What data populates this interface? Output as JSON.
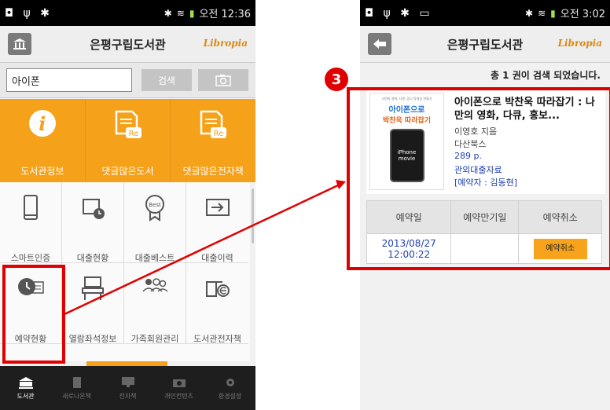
{
  "left_screen": {
    "status_time": "오전 12:36",
    "app_title": "은평구립도서관",
    "logo": "Libropia",
    "home_icon": "library-building-icon",
    "search": {
      "value": "아이폰",
      "button_label": "검색",
      "camera_icon": "camera-icon"
    },
    "orange_tiles": [
      {
        "label": "도서관정보",
        "icon": "info-icon"
      },
      {
        "label": "댓글많은도서",
        "icon": "reply-document-icon"
      },
      {
        "label": "댓글많은전자책",
        "icon": "reply-document-icon"
      }
    ],
    "grid_tiles": [
      {
        "label": "스마트인증",
        "icon": "smartphone-icon"
      },
      {
        "label": "대출현황",
        "icon": "card-clock-icon"
      },
      {
        "label": "대출베스트",
        "icon": "best-badge-icon"
      },
      {
        "label": "대출이력",
        "icon": "arrow-box-icon"
      },
      {
        "label": "예약현황",
        "icon": "clock-list-icon"
      },
      {
        "label": "열람좌석정보",
        "icon": "seat-icon"
      },
      {
        "label": "가족회원관리",
        "icon": "people-icon"
      },
      {
        "label": "도서관전자책",
        "icon": "ebook-icon"
      }
    ],
    "bottom_nav": [
      {
        "label": "도서관",
        "icon": "library-icon",
        "active": true
      },
      {
        "label": "새로나온책",
        "icon": "book-icon",
        "active": false
      },
      {
        "label": "전자책",
        "icon": "monitor-icon",
        "active": false
      },
      {
        "label": "개인컨텐츠",
        "icon": "camera-icon",
        "active": false
      },
      {
        "label": "환경설정",
        "icon": "gear-icon",
        "active": false
      }
    ]
  },
  "right_screen": {
    "status_time": "오전 3:02",
    "app_title": "은평구립도서관",
    "logo": "Libropia",
    "back_icon": "back-arrow-icon",
    "result_count": "총 1 권이 검색 되었습니다.",
    "book": {
      "title": "아이폰으로 박찬욱 따라잡기 : 나만의 영화, 다큐, 홍보...",
      "author": "이영호 지음",
      "publisher": "다산북스",
      "pages": "289 p.",
      "location": "관외대출자료",
      "reservation": "[예약자 : 김동현]",
      "cover_title_1": "아이폰으로",
      "cover_title_2": "박찬욱 따라잡기",
      "cover_small": "시민의 영화, 다큐, 광고 동영상 만들기",
      "cover_device": "iPhone",
      "cover_movie": "movie"
    },
    "table": {
      "headers": [
        "예약일",
        "예약만기일",
        "예약취소"
      ],
      "date_line1": "2013/08/27",
      "date_line2": "12:00:22",
      "expiry": "",
      "cancel_label": "예약취소"
    }
  },
  "annotation": {
    "step_number": "3",
    "accent": "#e00000"
  },
  "colors": {
    "orange": "#f5a11a",
    "red": "#e00000",
    "link_blue": "#1e3fb0"
  }
}
